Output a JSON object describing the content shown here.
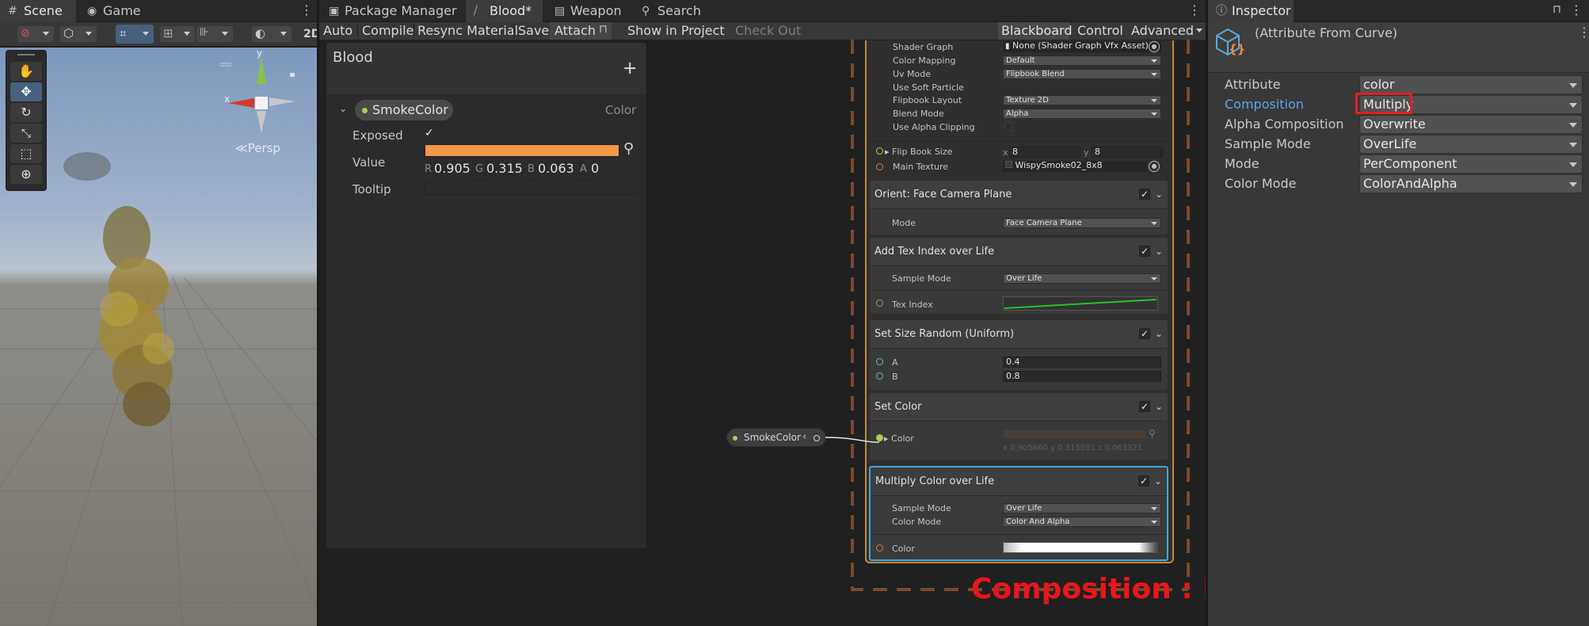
{
  "scene_panel": {
    "tabs": [
      {
        "label": "Scene",
        "icon": "grid-icon"
      },
      {
        "label": "Game",
        "icon": "gamepad-icon"
      }
    ],
    "toolbar_2d": "2D",
    "gizmo": {
      "x_label": "x",
      "y_label": "y",
      "persp_label": "≪Persp"
    }
  },
  "vfx_panel": {
    "tabs": [
      {
        "label": "Package Manager",
        "icon": "package-icon"
      },
      {
        "label": "Blood*",
        "icon": "vfx-graph-icon"
      },
      {
        "label": "Weapon",
        "icon": "weapon-icon"
      },
      {
        "label": "Search",
        "icon": "search-icon"
      }
    ],
    "toolbar": {
      "auto": "Auto",
      "compile": "Compile",
      "resync": "Resync Material",
      "save": "Save",
      "attach": "Attach",
      "show_in_project": "Show in Project",
      "check_out": "Check Out",
      "blackboard": "Blackboard",
      "control": "Control",
      "advanced": "Advanced"
    },
    "blackboard": {
      "title": "Blood",
      "add": "+",
      "property": {
        "name": "SmokeColor",
        "type": "Color",
        "exposed_label": "Exposed",
        "value_label": "Value",
        "tooltip_label": "Tooltip",
        "color_hex": "#F39748",
        "r": "0.905",
        "g": "0.315",
        "b": "0.063",
        "a": "0"
      }
    },
    "output_context": {
      "rows": [
        {
          "label": "Shader Graph",
          "value": "None (Shader Graph Vfx Asset)"
        },
        {
          "label": "Color Mapping",
          "value": "Default"
        },
        {
          "label": "Uv Mode",
          "value": "Flipbook Blend"
        },
        {
          "label": "Use Soft Particle",
          "value": ""
        },
        {
          "label": "Flipbook Layout",
          "value": "Texture 2D"
        },
        {
          "label": "Blend Mode",
          "value": "Alpha"
        },
        {
          "label": "Use Alpha Clipping",
          "value": ""
        }
      ],
      "flipbook_size_label": "Flip Book Size",
      "flipbook_x": "8",
      "flipbook_y": "8",
      "main_texture_label": "Main Texture",
      "main_texture_value": "WispySmoke02_8x8"
    },
    "blocks": {
      "orient": {
        "title": "Orient: Face Camera Plane",
        "mode_label": "Mode",
        "mode_value": "Face Camera Plane"
      },
      "tex_index": {
        "title": "Add Tex Index over Life",
        "sample_mode_label": "Sample Mode",
        "sample_mode_value": "Over Life",
        "tex_index_label": "Tex Index"
      },
      "size_random": {
        "title": "Set Size Random (Uniform)",
        "a_label": "A",
        "a_value": "0.4",
        "b_label": "B",
        "b_value": "0.8"
      },
      "set_color": {
        "title": "Set Color",
        "color_label": "Color",
        "color_values": "x 0.905660  y 0.315031  z 0.063321"
      },
      "multiply_color": {
        "title": "Multiply Color over Life",
        "sample_mode_label": "Sample Mode",
        "sample_mode_value": "Over Life",
        "color_mode_label": "Color Mode",
        "color_mode_value": "Color And Alpha",
        "color_label": "Color"
      }
    },
    "smoke_node": {
      "label": "SmokeColor",
      "chevron": "‹"
    }
  },
  "inspector": {
    "tab": "Inspector",
    "subtitle": "(Attribute From Curve)",
    "rows": [
      {
        "label": "Attribute",
        "value": "color"
      },
      {
        "label": "Composition",
        "value": "Multiply"
      },
      {
        "label": "Alpha Composition",
        "value": "Overwrite"
      },
      {
        "label": "Sample Mode",
        "value": "OverLife"
      },
      {
        "label": "Mode",
        "value": "PerComponent"
      },
      {
        "label": "Color Mode",
        "value": "ColorAndAlpha"
      }
    ]
  },
  "annotation": {
    "text": "Composition : Multiply로 변경해야합니다.",
    "color": "#E8161B"
  },
  "colors": {
    "accent_blue": "#3D85D6",
    "highlight_red": "#E02020",
    "context_orange": "#C58A3A",
    "dashed_brown": "#7A4A2E"
  }
}
